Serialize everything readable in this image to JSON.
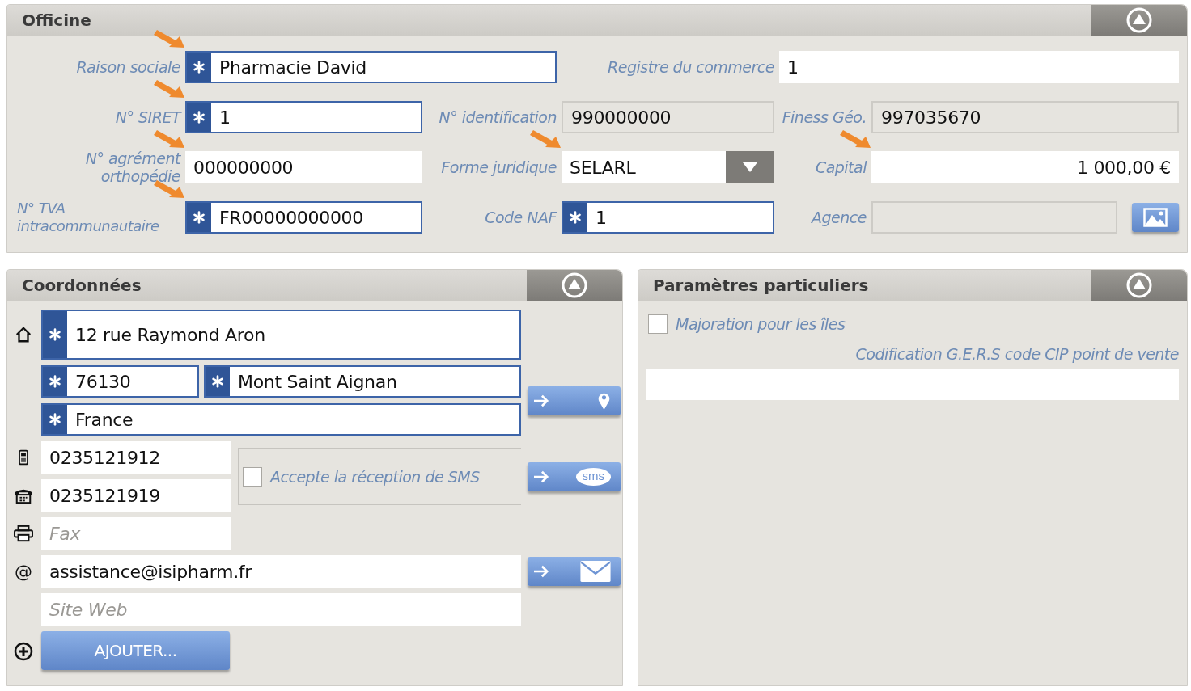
{
  "officine": {
    "title": "Officine",
    "fields": [
      {
        "label": "Raison sociale",
        "value": "Pharmacie David",
        "required": true,
        "disabled": false,
        "kind": "text"
      },
      {
        "label": "Registre du commerce",
        "value": "1",
        "required": false,
        "disabled": false,
        "kind": "text"
      },
      {
        "label": "N° SIRET",
        "value": "1",
        "required": true,
        "disabled": false,
        "kind": "text"
      },
      {
        "label": "N° identification",
        "value": "990000000",
        "required": false,
        "disabled": true,
        "kind": "text"
      },
      {
        "label": "Finess Géo.",
        "value": "997035670",
        "required": false,
        "disabled": true,
        "kind": "text"
      },
      {
        "label": "N° agrément orthopédie",
        "value": "000000000",
        "required": false,
        "disabled": false,
        "kind": "text"
      },
      {
        "label": "Forme juridique",
        "value": "SELARL",
        "required": false,
        "disabled": false,
        "kind": "select"
      },
      {
        "label": "Capital",
        "value": "1 000,00 €",
        "required": false,
        "disabled": false,
        "kind": "amount"
      },
      {
        "label": "N° TVA intracommunautaire",
        "value": "FR00000000000",
        "required": true,
        "disabled": false,
        "kind": "text"
      },
      {
        "label": "Code NAF",
        "value": "1",
        "required": true,
        "disabled": false,
        "kind": "text"
      },
      {
        "label": "Agence",
        "required": false,
        "disabled": true,
        "kind": "image"
      }
    ]
  },
  "coordonnees": {
    "title": "Coordonnées",
    "address": {
      "value": "12 rue Raymond Aron",
      "required": true
    },
    "postal_code": {
      "value": "76130",
      "required": true
    },
    "city": {
      "value": "Mont Saint Aignan",
      "required": true
    },
    "country": {
      "value": "France",
      "required": true
    },
    "mobile": {
      "value": "0235121912"
    },
    "phone": {
      "value": "0235121919"
    },
    "fax": {
      "placeholder": "Fax"
    },
    "email": {
      "icon": "@",
      "value": "assistance@isipharm.fr"
    },
    "website": {
      "placeholder": "Site Web"
    },
    "sms_checkbox": {
      "label": "Accepte la réception de SMS",
      "checked": false
    },
    "sms_button": {
      "label": "sms"
    },
    "add_button": {
      "label": "AJOUTER..."
    }
  },
  "parametres": {
    "title": "Paramètres particuliers",
    "majoration": {
      "label": "Majoration pour les îles",
      "checked": false
    },
    "codification": {
      "label": "Codification G.E.R.S code CIP point de vente"
    }
  }
}
